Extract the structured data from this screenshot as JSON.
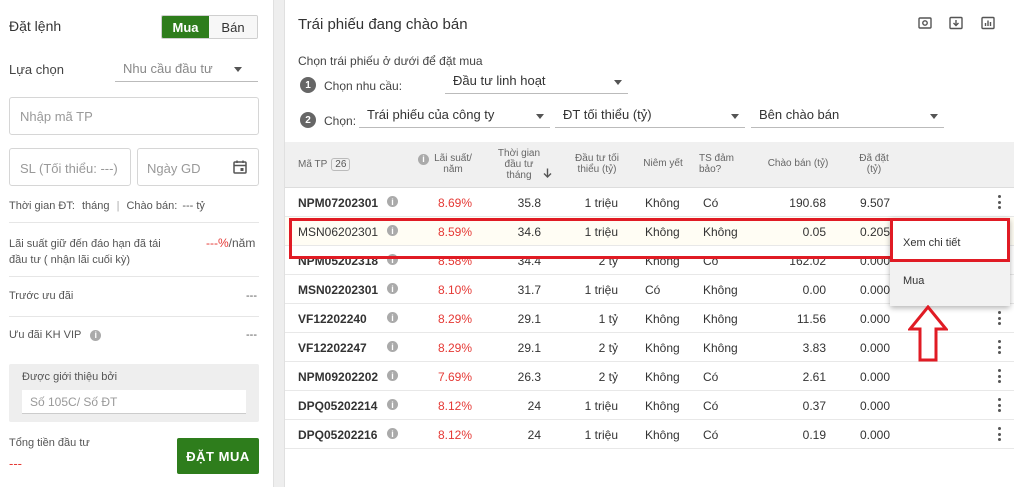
{
  "order": {
    "title": "Đặt lệnh",
    "buy_label": "Mua",
    "sell_label": "Bán",
    "choice_label": "Lựa chọn",
    "need_placeholder": "Nhu cầu đầu tư",
    "code_placeholder": "Nhập mã TP",
    "qty_placeholder": "SL (Tối thiểu: ---)",
    "date_placeholder": "Ngày GD",
    "term_label": "Thời gian ĐT:",
    "term_value": "tháng",
    "offer_label": "Chào bán:",
    "offer_value": "--- tỷ",
    "rate_hold_label": "Lãi suất giữ đến đáo hạn đã tái đầu tư ( nhận lãi cuối kỳ)",
    "rate_hold_value": "---%",
    "rate_hold_unit": "/năm",
    "pre_discount_label": "Trước ưu đãi",
    "pre_discount_value": "---",
    "vip_label": "Ưu đãi KH VIP",
    "vip_value": "---",
    "referred_label": "Được giới thiệu bởi",
    "referred_placeholder": "Số 105C/ Số ĐT",
    "total_label": "Tổng tiền đầu tư",
    "total_value": "---",
    "order_button": "ĐẶT MUA"
  },
  "bonds": {
    "title": "Trái phiếu đang chào bán",
    "instruction": "Chọn trái phiếu ở dưới để đặt mua",
    "step1": "1",
    "step1_label": "Chọn nhu cầu:",
    "step1_value": "Đầu tư linh hoạt",
    "step2": "2",
    "step2_label": "Chọn:",
    "filter_type": "Trái phiếu của công ty",
    "filter_min": "ĐT tối thiểu (tỷ)",
    "filter_seller": "Bên chào bán",
    "headers": {
      "code": "Mã TP",
      "count": "26",
      "rate": "Lãi suất/ năm",
      "term": "Thời gian đầu tư tháng",
      "min": "Đầu tư tối thiểu (tỷ)",
      "listed": "Niêm yết",
      "collateral": "TS đảm bảo?",
      "offer": "Chào bán (tỷ)",
      "placed": "Đã đặt (tỷ)"
    },
    "rows": [
      {
        "code": "NPM07202301",
        "rate": "8.69%",
        "term": "35.8",
        "min": "1 triệu",
        "listed": "Không",
        "collateral": "Có",
        "offer": "190.68",
        "placed": "9.507"
      },
      {
        "code": "MSN06202301",
        "rate": "8.59%",
        "term": "34.6",
        "min": "1 triệu",
        "listed": "Không",
        "collateral": "Không",
        "offer": "0.05",
        "placed": "0.205"
      },
      {
        "code": "NPM05202318",
        "rate": "8.58%",
        "term": "34.4",
        "min": "2 tỷ",
        "listed": "Không",
        "collateral": "Có",
        "offer": "162.02",
        "placed": "0.000"
      },
      {
        "code": "MSN02202301",
        "rate": "8.10%",
        "term": "31.7",
        "min": "1 triệu",
        "listed": "Có",
        "collateral": "Không",
        "offer": "0.00",
        "placed": "0.000"
      },
      {
        "code": "VF12202240",
        "rate": "8.29%",
        "term": "29.1",
        "min": "1 tỷ",
        "listed": "Không",
        "collateral": "Không",
        "offer": "11.56",
        "placed": "0.000"
      },
      {
        "code": "VF12202247",
        "rate": "8.29%",
        "term": "29.1",
        "min": "2 tỷ",
        "listed": "Không",
        "collateral": "Không",
        "offer": "3.83",
        "placed": "0.000"
      },
      {
        "code": "NPM09202202",
        "rate": "7.69%",
        "term": "26.3",
        "min": "2 tỷ",
        "listed": "Không",
        "collateral": "Có",
        "offer": "2.61",
        "placed": "0.000"
      },
      {
        "code": "DPQ05202214",
        "rate": "8.12%",
        "term": "24",
        "min": "1 triệu",
        "listed": "Không",
        "collateral": "Có",
        "offer": "0.37",
        "placed": "0.000"
      },
      {
        "code": "DPQ05202216",
        "rate": "8.12%",
        "term": "24",
        "min": "1 triệu",
        "listed": "Không",
        "collateral": "Có",
        "offer": "0.19",
        "placed": "0.000"
      }
    ],
    "menu": {
      "detail": "Xem chi tiết",
      "buy": "Mua"
    }
  },
  "colors": {
    "brand_green": "#2e7d1c",
    "rate_red": "#e53935",
    "highlight_red": "#e01b24"
  }
}
